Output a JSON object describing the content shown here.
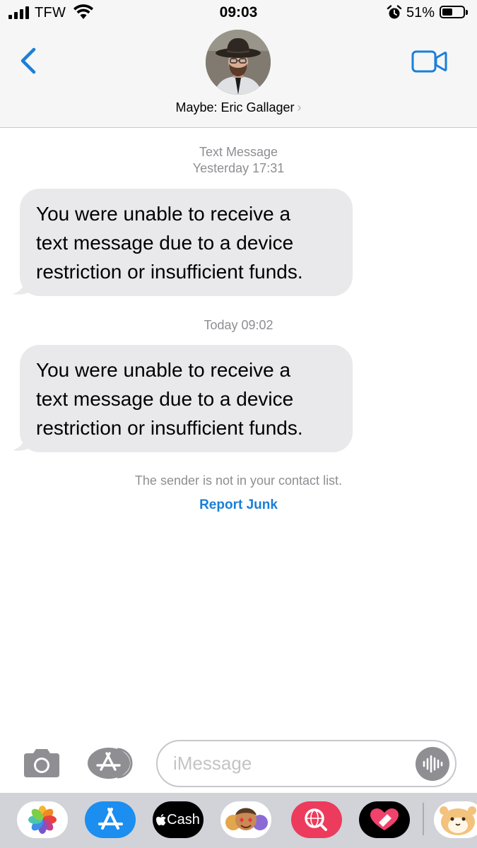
{
  "status_bar": {
    "carrier": "TFW",
    "time": "09:03",
    "battery_percent": "51%",
    "battery_level": 0.51,
    "icons": [
      "signal-icon",
      "wifi-icon",
      "alarm-icon",
      "battery-icon"
    ]
  },
  "header": {
    "contact_name": "Maybe: Eric Gallager",
    "chevron": "›",
    "icons": [
      "back-chevron-icon",
      "video-camera-icon"
    ]
  },
  "conversation": {
    "first_group": {
      "service": "Text Message",
      "timestamp": "Yesterday 17:31",
      "message_lines": [
        "You were unable to receive a",
        "text message due to a device",
        "restriction or insufficient funds."
      ]
    },
    "second_group": {
      "timestamp": "Today 09:02",
      "message_lines": [
        "You were unable to receive a",
        "text message due to a device",
        "restriction or insufficient funds."
      ]
    },
    "notice": "The sender is not in your contact list.",
    "report_junk": "Report Junk"
  },
  "input_bar": {
    "placeholder": "iMessage",
    "icons": [
      "camera-icon",
      "app-store-icon",
      "audio-waveform-icon"
    ]
  },
  "app_drawer": {
    "apps": [
      {
        "name": "photos-app-icon",
        "label": ""
      },
      {
        "name": "app-store-app-icon",
        "label": ""
      },
      {
        "name": "cash-app-icon",
        "label": "Cash"
      },
      {
        "name": "memoji-app-icon",
        "label": ""
      },
      {
        "name": "web-search-app-icon",
        "label": ""
      },
      {
        "name": "digital-touch-app-icon",
        "label": ""
      },
      {
        "name": "hamster-sticker-app-icon",
        "label": ""
      }
    ],
    "colors": {
      "accent": "#1a7fd9",
      "bubble": "#e9e9eb",
      "secondary_text": "#8e8e93"
    }
  }
}
